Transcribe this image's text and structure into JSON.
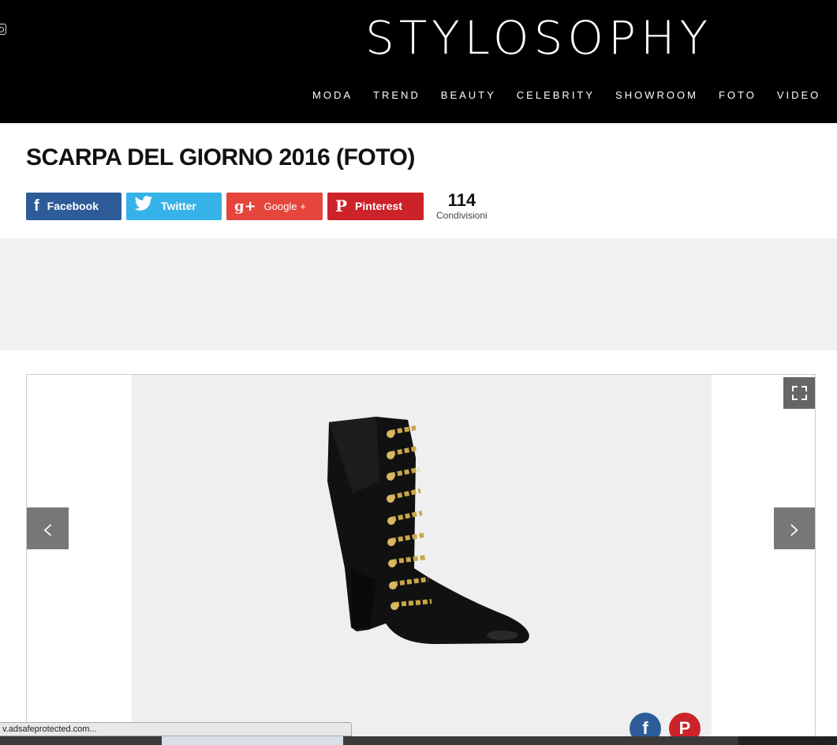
{
  "header": {
    "logo": "STYLOSOPHY",
    "nav": [
      "MODA",
      "TREND",
      "BEAUTY",
      "CELEBRITY",
      "SHOWROOM",
      "FOTO",
      "VIDEO"
    ]
  },
  "article": {
    "title": "SCARPA DEL GIORNO 2016 (FOTO)"
  },
  "share": {
    "facebook_label": "Facebook",
    "twitter_label": "Twitter",
    "google_label": "Google +",
    "google_icon": "g+",
    "pinterest_label": "Pinterest",
    "count": "114",
    "count_label": "Condivisioni"
  },
  "gallery": {
    "prev_glyph": "‹",
    "next_glyph": "›"
  },
  "statusbar": {
    "text": "v.adsafeprotected.com..."
  },
  "colors": {
    "facebook": "#2d5c98",
    "twitter": "#35b3e8",
    "google": "#e5453a",
    "pinterest": "#cc2229"
  }
}
